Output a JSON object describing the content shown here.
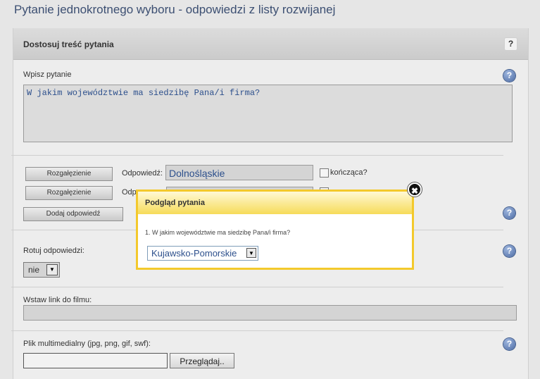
{
  "page": {
    "title": "Pytanie jednokrotnego wyboru - odpowiedzi z listy rozwijanej"
  },
  "panel": {
    "title": "Dostosuj treść pytania",
    "help_plain": "?",
    "help_blue": "?"
  },
  "question": {
    "label": "Wpisz pytanie",
    "value": "W jakim województwie ma siedzibę Pana/i firma?"
  },
  "answers": {
    "branch_label": "Rozgałęzienie",
    "answer_label": "Odpowiedź:",
    "answer_label_partial": "Odp",
    "ending_label": "kończąca?",
    "add_label": "Dodaj odpowiedź",
    "items": [
      {
        "value": "Dolnośląskie"
      }
    ]
  },
  "rotate": {
    "label": "Rotuj odpowiedzi:",
    "value": "nie"
  },
  "video": {
    "label": "Wstaw link do filmu:"
  },
  "media": {
    "label": "Plik multimedialny (jpg, png, gif, swf):",
    "browse_label": "Przeglądaj.."
  },
  "modal": {
    "title": "Podgląd pytania",
    "question": "1. W jakim województwie ma siedzibę Pana/i firma?",
    "selected": "Kujawsko-Pomorskie",
    "close_symbol": "✖"
  },
  "icons": {
    "dropdown_arrow": "▼"
  }
}
